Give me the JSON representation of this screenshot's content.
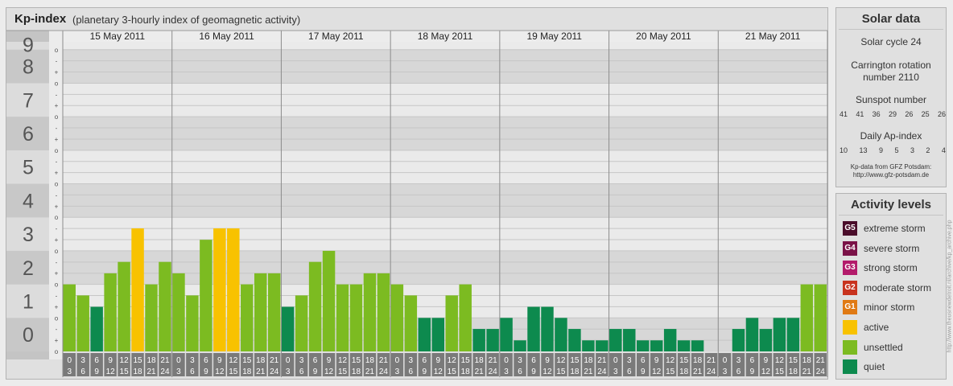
{
  "title": "Kp-index",
  "subtitle": "(planetary 3-hourly index of geomagnetic activity)",
  "chart_data": {
    "type": "bar",
    "ylim": [
      0,
      9
    ],
    "y_ticks": [
      "0",
      "1",
      "2",
      "3",
      "4",
      "5",
      "6",
      "7",
      "8",
      "9"
    ],
    "y_minor_labels": [
      "+",
      "o",
      "-"
    ],
    "days": [
      "15 May 2011",
      "16 May 2011",
      "17 May 2011",
      "18 May 2011",
      "19 May 2011",
      "20 May 2011",
      "21 May 2011"
    ],
    "hour_bins_top": [
      "0",
      "3",
      "6",
      "9",
      "12",
      "15",
      "18",
      "21"
    ],
    "hour_bins_bottom": [
      "3",
      "6",
      "9",
      "12",
      "15",
      "18",
      "21",
      "24"
    ],
    "values": [
      [
        2.0,
        1.67,
        1.33,
        2.33,
        2.67,
        3.67,
        2.0,
        2.67
      ],
      [
        2.33,
        1.67,
        3.33,
        3.67,
        3.67,
        2.0,
        2.33,
        2.33
      ],
      [
        1.33,
        1.67,
        2.67,
        3.0,
        2.0,
        2.0,
        2.33,
        2.33
      ],
      [
        2.0,
        1.67,
        1.0,
        1.0,
        1.67,
        2.0,
        0.67,
        0.67
      ],
      [
        1.0,
        0.33,
        1.33,
        1.33,
        1.0,
        0.67,
        0.33,
        0.33
      ],
      [
        0.67,
        0.67,
        0.33,
        0.33,
        0.67,
        0.33,
        0.33,
        0.0
      ],
      [
        0.0,
        0.67,
        1.0,
        0.67,
        1.0,
        1.0,
        2.0,
        2.0
      ]
    ],
    "level_colors": {
      "quiet": "#0d8a4e",
      "unsettled": "#7cbb21",
      "active": "#f8c200"
    },
    "grid": true
  },
  "solar": {
    "title": "Solar data",
    "cycle": "Solar cycle 24",
    "carrington": "Carrington rotation number 2110",
    "sunspot_label": "Sunspot number",
    "sunspot_values": [
      "41",
      "41",
      "36",
      "29",
      "26",
      "25",
      "26"
    ],
    "ap_label": "Daily Ap-index",
    "ap_values": [
      "10",
      "13",
      "9",
      "5",
      "3",
      "2",
      "4"
    ],
    "source_line1": "Kp-data from GFZ Potsdam:",
    "source_line2": "http://www.gfz-potsdam.de"
  },
  "activity": {
    "title": "Activity levels",
    "levels": [
      {
        "code": "G5",
        "label": "extreme storm",
        "color": "#4a0d2a"
      },
      {
        "code": "G4",
        "label": "severe storm",
        "color": "#7a1247"
      },
      {
        "code": "G3",
        "label": "strong storm",
        "color": "#b31b6b"
      },
      {
        "code": "G2",
        "label": "moderate storm",
        "color": "#c8331e"
      },
      {
        "code": "G1",
        "label": "minor storm",
        "color": "#e07a14"
      },
      {
        "code": "",
        "label": "active",
        "color": "#f8c200"
      },
      {
        "code": "",
        "label": "unsettled",
        "color": "#7cbb21"
      },
      {
        "code": "",
        "label": "quiet",
        "color": "#0d8a4e"
      }
    ]
  },
  "watermark": "http://www.theusnewdetroit.nl/archive/kp_archive.php"
}
